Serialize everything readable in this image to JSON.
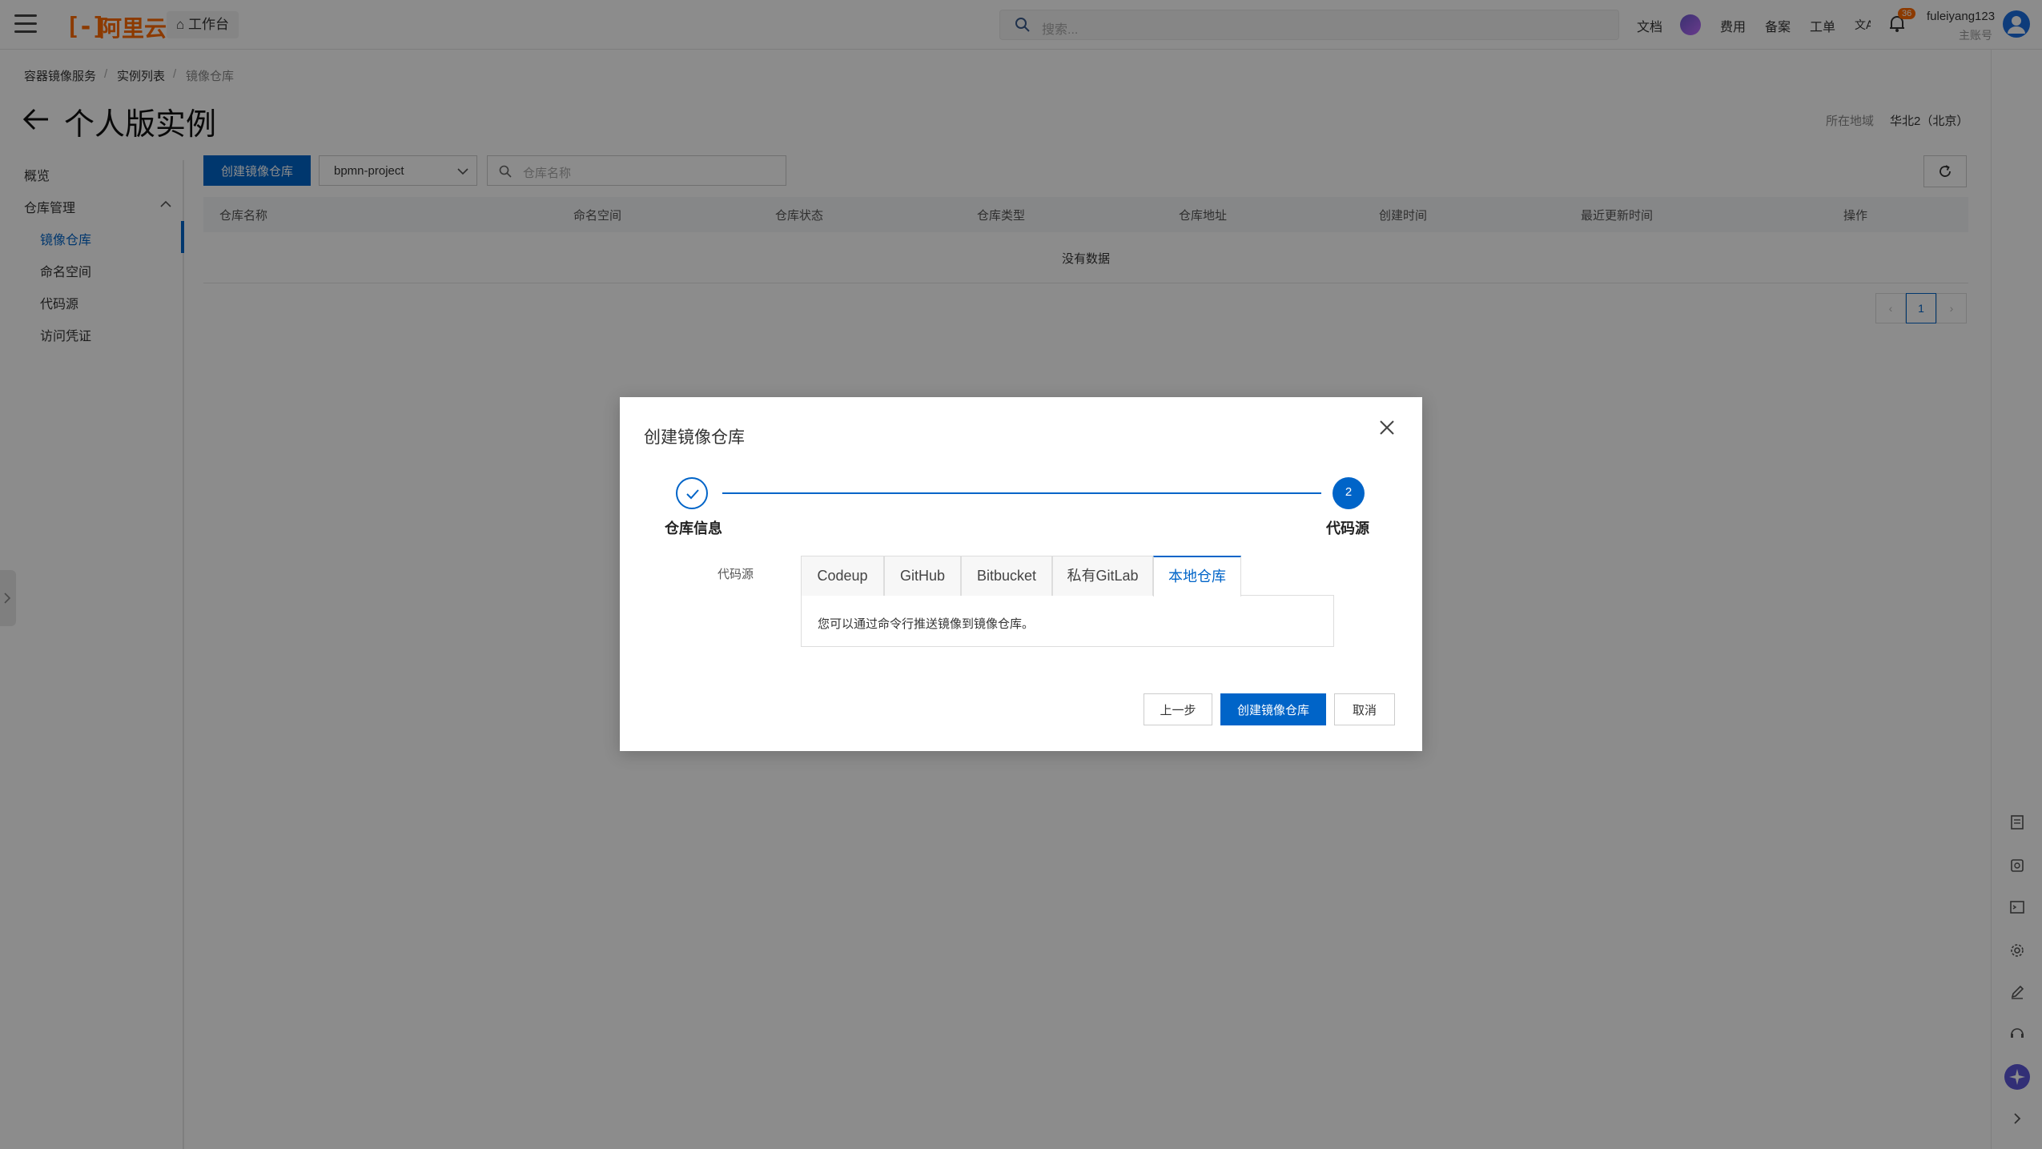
{
  "header": {
    "logo_text": "阿里云",
    "workbench_label": "工作台",
    "search_placeholder": "搜索...",
    "nav": [
      "文档",
      "费用",
      "备案",
      "工单"
    ],
    "notification_count": "36",
    "user_name": "fuleiyang123",
    "user_role": "主账号"
  },
  "breadcrumb": [
    "容器镜像服务",
    "实例列表",
    "镜像仓库"
  ],
  "page": {
    "title": "个人版实例",
    "region_label": "所在地域",
    "region_value": "华北2（北京）"
  },
  "sidebar": {
    "overview": "概览",
    "group_label": "仓库管理",
    "items": [
      "镜像仓库",
      "命名空间",
      "代码源",
      "访问凭证"
    ]
  },
  "toolbar": {
    "create_button": "创建镜像仓库",
    "namespace_value": "bpmn-project",
    "search_placeholder": "仓库名称"
  },
  "table": {
    "columns": [
      "仓库名称",
      "命名空间",
      "仓库状态",
      "仓库类型",
      "仓库地址",
      "创建时间",
      "最近更新时间",
      "操作"
    ],
    "empty_text": "没有数据",
    "page": "1"
  },
  "dialog": {
    "title": "创建镜像仓库",
    "steps": [
      {
        "label": "仓库信息",
        "status": "done"
      },
      {
        "label": "代码源",
        "number": "2",
        "status": "current"
      }
    ],
    "field_label": "代码源",
    "tabs": [
      "Codeup",
      "GitHub",
      "Bitbucket",
      "私有GitLab",
      "本地仓库"
    ],
    "active_tab": "本地仓库",
    "panel_text": "您可以通过命令行推送镜像到镜像仓库。",
    "prev_button": "上一步",
    "create_button": "创建镜像仓库",
    "cancel_button": "取消"
  },
  "colors": {
    "primary": "#0064c8",
    "brand": "#ff6a00"
  }
}
